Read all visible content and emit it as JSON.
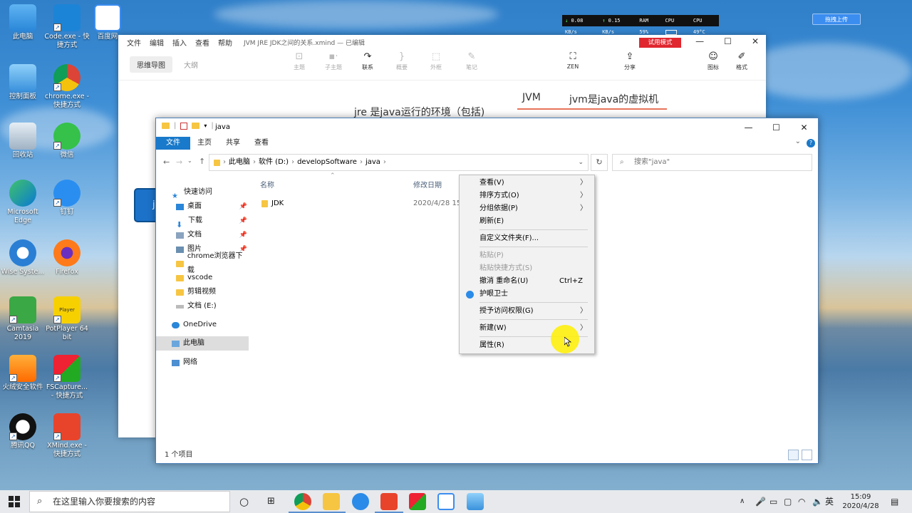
{
  "desktop": {
    "icons": [
      {
        "label": "此电脑"
      },
      {
        "label": "Code.exe - 快捷方式"
      },
      {
        "label": "百度网"
      },
      {
        "label": "控制面板"
      },
      {
        "label": "chrome.exe - 快捷方式"
      },
      {
        "label": "回收站"
      },
      {
        "label": "微信"
      },
      {
        "label": "Microsoft Edge"
      },
      {
        "label": "钉钉"
      },
      {
        "label": "Wise Syste..."
      },
      {
        "label": "Firefox"
      },
      {
        "label": "Camtasia 2019"
      },
      {
        "label": "PotPlayer 64 bit"
      },
      {
        "label": "火绒安全软件"
      },
      {
        "label": "FSCapture... - 快捷方式"
      },
      {
        "label": "腾讯QQ"
      },
      {
        "label": "XMind.exe - 快捷方式"
      }
    ],
    "potplayer_badge": "Player"
  },
  "perf_widget": {
    "down": "0.08 KB/s",
    "up": "0.15 KB/s",
    "ram": "RAM 59%",
    "cpu": "CPU",
    "cpu_temp": "CPU 49°C"
  },
  "baidu_float": {
    "label": "拖拽上传"
  },
  "xmind": {
    "menus": [
      "文件",
      "编辑",
      "插入",
      "查看",
      "帮助"
    ],
    "title": "JVM JRE JDK之间的关系.xmind — 已编辑",
    "trial_badge": "试用模式",
    "view_tabs": [
      "思维导图",
      "大纲"
    ],
    "tools": [
      {
        "label": "主题",
        "glyph": "⊡"
      },
      {
        "label": "子主题",
        "glyph": "▪·"
      },
      {
        "label": "联系",
        "glyph": "↷"
      },
      {
        "label": "概要",
        "glyph": "}"
      },
      {
        "label": "外框",
        "glyph": "⬚"
      },
      {
        "label": "笔记",
        "glyph": "✎"
      },
      {
        "label": "ZEN",
        "glyph": "⛶"
      },
      {
        "label": "分享",
        "glyph": "⇪"
      },
      {
        "label": "图标",
        "glyph": "☺"
      },
      {
        "label": "格式",
        "glyph": "✐"
      }
    ],
    "canvas": {
      "node_jvm": "JVM",
      "node_jvm_desc": "jvm是java的虚拟机",
      "node_jre": "jre 是java运行的环境（包括)",
      "node_left_partial": "j"
    }
  },
  "explorer": {
    "title": "java",
    "ribbon_tabs": [
      "文件",
      "主页",
      "共享",
      "查看"
    ],
    "breadcrumb": [
      "此电脑",
      "软件 (D:)",
      "developSoftware",
      "java"
    ],
    "search_placeholder": "搜索\"java\"",
    "nav": {
      "quick_access": "快速访问",
      "items": [
        {
          "label": "桌面",
          "pinned": true
        },
        {
          "label": "下载",
          "pinned": true
        },
        {
          "label": "文档",
          "pinned": true
        },
        {
          "label": "图片",
          "pinned": true
        },
        {
          "label": "chrome浏览器下载",
          "pinned": false
        },
        {
          "label": "vscode",
          "pinned": false
        },
        {
          "label": "剪辑视频",
          "pinned": false
        },
        {
          "label": "文档 (E:)",
          "pinned": false
        }
      ],
      "onedrive": "OneDrive",
      "this_pc": "此电脑",
      "network": "网络"
    },
    "columns": {
      "name": "名称",
      "date": "修改日期"
    },
    "files": [
      {
        "name": "JDK",
        "date": "2020/4/28 15"
      }
    ],
    "status": "1 个项目"
  },
  "context_menu": {
    "items": [
      {
        "label": "查看(V)",
        "submenu": true,
        "disabled": false
      },
      {
        "label": "排序方式(O)",
        "submenu": true,
        "disabled": false
      },
      {
        "label": "分组依据(P)",
        "submenu": true,
        "disabled": false
      },
      {
        "label": "刷新(E)",
        "submenu": false,
        "disabled": false
      },
      {
        "label": "自定义文件夹(F)...",
        "submenu": false,
        "disabled": false
      },
      {
        "label": "粘贴(P)",
        "submenu": false,
        "disabled": true
      },
      {
        "label": "粘贴快捷方式(S)",
        "submenu": false,
        "disabled": true
      },
      {
        "label": "撤消 重命名(U)",
        "submenu": false,
        "disabled": false,
        "accel": "Ctrl+Z"
      },
      {
        "label": "护眼卫士",
        "submenu": false,
        "disabled": false
      },
      {
        "label": "授予访问权限(G)",
        "submenu": true,
        "disabled": false
      },
      {
        "label": "新建(W)",
        "submenu": true,
        "disabled": false
      },
      {
        "label": "属性(R)",
        "submenu": false,
        "disabled": false
      }
    ]
  },
  "taskbar": {
    "search_placeholder": "在这里输入你要搜索的内容",
    "ime": "英",
    "time": "15:09",
    "date": "2020/4/28"
  }
}
